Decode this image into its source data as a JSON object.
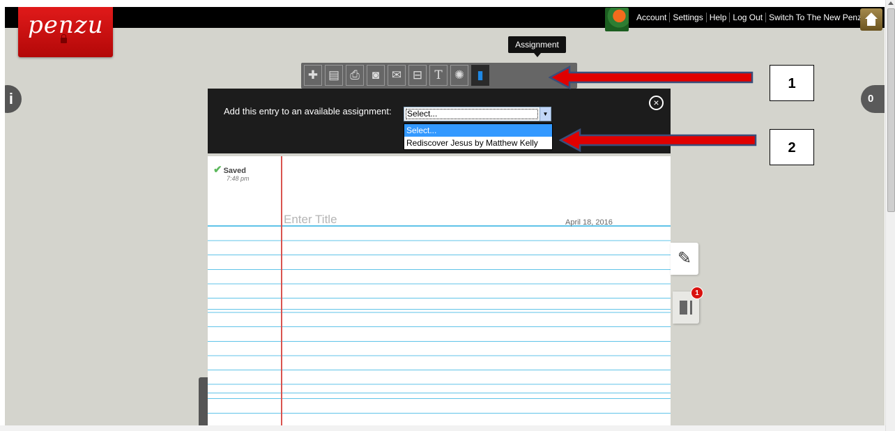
{
  "app": {
    "logo": "penzu"
  },
  "topbar": {
    "links": [
      "Account",
      "Settings",
      "Help",
      "Log Out",
      "Switch To The New Penzu"
    ]
  },
  "toolbar": {
    "tooltip": "Assignment",
    "icons": [
      "plus-icon",
      "document-icon",
      "print-icon",
      "photo-icon",
      "email-icon",
      "archive-icon",
      "font-icon",
      "sparkle-icon",
      "assignment-icon"
    ]
  },
  "assignment": {
    "label": "Add this entry to an available assignment:",
    "selected": "Select...",
    "options": [
      "Select...",
      "Rediscover Jesus by Matthew Kelly"
    ],
    "close_icon": "close-circle-icon"
  },
  "entry": {
    "status": "Saved",
    "time": "7:48 pm",
    "title_placeholder": "Enter Title",
    "date": "April 18, 2016"
  },
  "side": {
    "info_label": "i",
    "notebook_badge": "1",
    "page_count": "0"
  },
  "callouts": [
    "1",
    "2"
  ],
  "colors": {
    "logo_red": "#d41414",
    "arrow_red": "#e00000",
    "line_blue": "#5fc3e8",
    "margin_red": "#d9534f",
    "accent_blue": "#1e88e5"
  }
}
